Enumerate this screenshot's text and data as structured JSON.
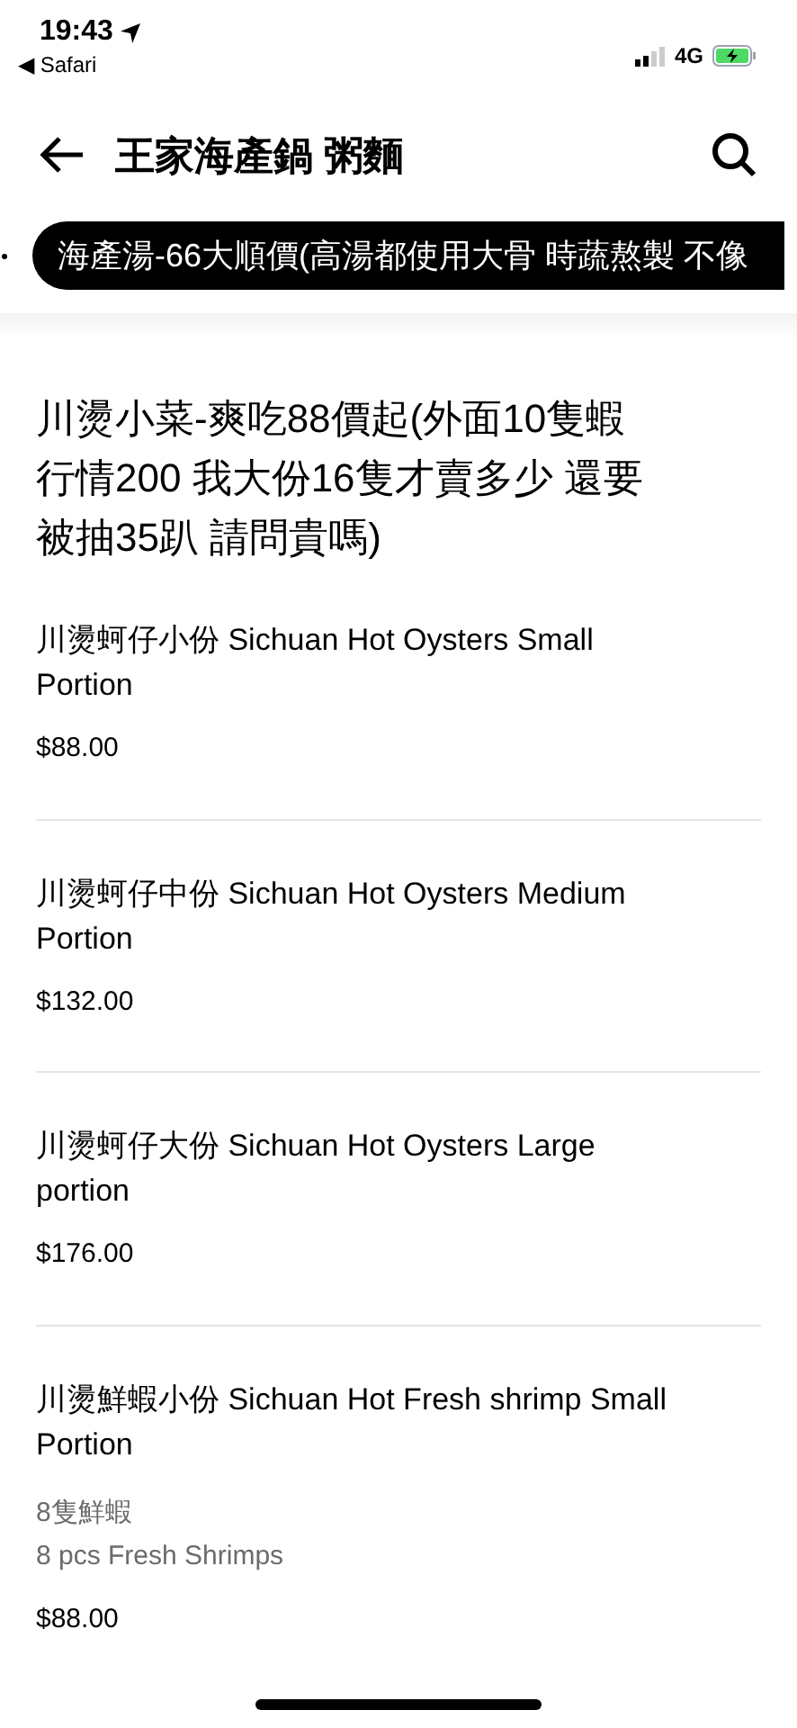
{
  "status_bar": {
    "time": "19:43",
    "back_app": "◀ Safari",
    "network": "4G"
  },
  "header": {
    "title": "王家海產鍋 粥麵"
  },
  "category_chips": [
    {
      "label": "海產湯-66大順價(高湯都使用大骨 時蔬熬製 不像",
      "selected": true
    }
  ],
  "section": {
    "title": "川燙小菜-爽吃88價起(外面10隻蝦行情200  我大份16隻才賣多少 還要被抽35趴 請問貴嗎)"
  },
  "items": [
    {
      "name": "川燙蚵仔小份 Sichuan Hot Oysters Small Portion",
      "price": "$88.00"
    },
    {
      "name": "川燙蚵仔中份 Sichuan Hot Oysters Medium Portion",
      "price": "$132.00"
    },
    {
      "name": "川燙蚵仔大份 Sichuan Hot Oysters Large portion",
      "price": "$176.00"
    },
    {
      "name": "川燙鮮蝦小份 Sichuan Hot Fresh shrimp Small Portion",
      "description": [
        "8隻鮮蝦",
        "8 pcs Fresh Shrimps"
      ],
      "price": "$88.00"
    }
  ]
}
